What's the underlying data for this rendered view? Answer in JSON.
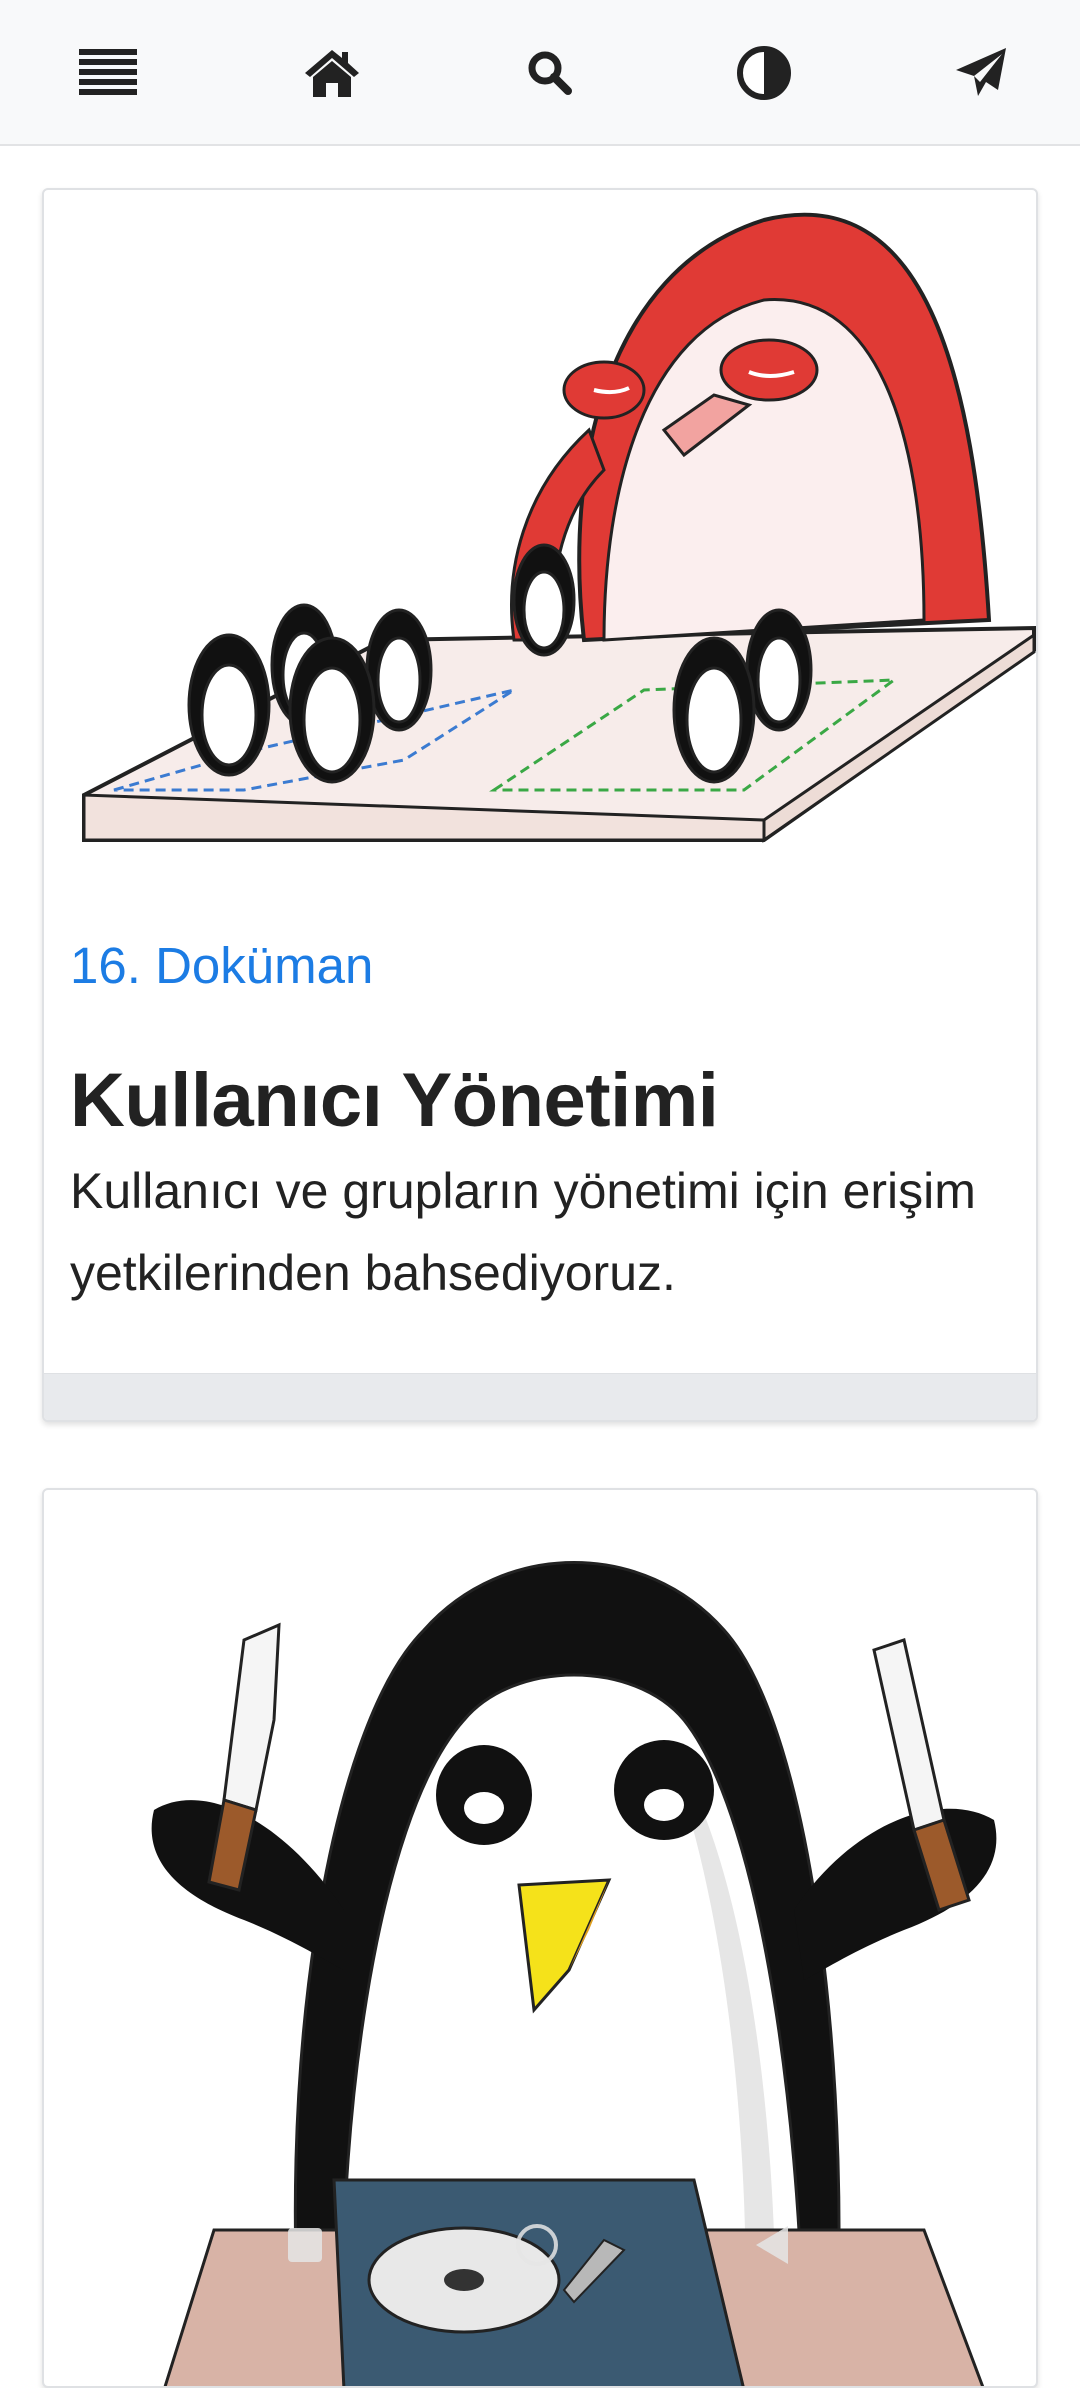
{
  "navbar": {
    "items": [
      {
        "icon": "menu-icon"
      },
      {
        "icon": "home-icon"
      },
      {
        "icon": "search-icon"
      },
      {
        "icon": "contrast-icon"
      },
      {
        "icon": "send-icon"
      }
    ]
  },
  "cards": [
    {
      "image": "penguin-administrator-illustration",
      "doc_number": "16. Doküman",
      "title": "Kullanıcı Yönetimi",
      "description": "Kullanıcı ve grupların yönetimi için erişim yetkilerinden bahsediyoruz."
    },
    {
      "image": "penguin-with-knives-and-hard-drive-illustration"
    }
  ],
  "colors": {
    "link": "#1c7ce4",
    "navbar_bg": "#f8f9fa",
    "card_footer": "#e8eaed"
  },
  "system_nav": {
    "items": [
      {
        "icon": "recents-icon"
      },
      {
        "icon": "home-circle-icon"
      },
      {
        "icon": "back-icon"
      }
    ]
  }
}
